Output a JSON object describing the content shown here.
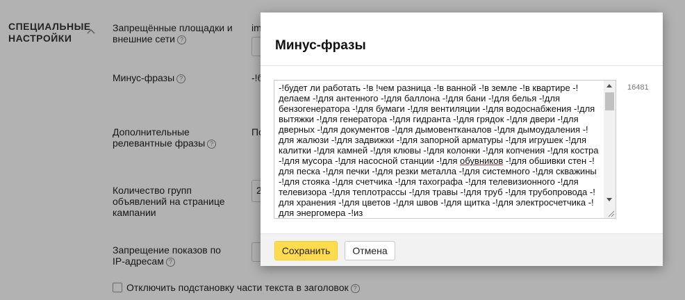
{
  "settings": {
    "section_title": "СПЕЦИАЛЬНЫЕ НАСТРОЙКИ",
    "rows": [
      {
        "label": "Запрещённые площадки и внешние сети",
        "peek": "im"
      },
      {
        "label": "Минус-фразы",
        "peek": "-!б"
      },
      {
        "label": "Дополнительные релевантные фразы",
        "peek": "По"
      },
      {
        "label": "Количество групп объявлений на странице кампании",
        "peek": "2"
      },
      {
        "label": "Запрещение показов по IP-адресам",
        "peek": ""
      }
    ],
    "checkbox_label": "Отключить подстановку части текста в заголовок",
    "help_glyph": "?"
  },
  "modal": {
    "title": "Минус-фразы",
    "text_before_underline": "-!будет ли работать -!в !чем разница -!в ванной -!в земле -!в квартире -!делаем -!для антенного -!для баллона -!для бани -!для белья -!для бензогенератора -!для бумаги -!для вентиляции -!для водоснабжения -!для вытяжки -!для генератора -!для гидранта -!для грядок -!для двери -!для дверных -!для документов -!для дымовентканалов -!для дымоудаления -!для жалюзи -!для задвижки -!для запорной арматуры -!для игрушек -!для калитки -!для камней -!для клювы -!для колонки -!для копчения -!для костра -!для мусора -!для насосной станции -!для ",
    "underlined_word": "обувников",
    "text_after_underline": " -!для обшивки стен -!для песка -!для печки -!для резки металла -!для системного -!для скважины -!для стояка -!для счетчика -!для тахографа -!для телевизионного -!для телевизора -!для теплотрассы -!для травы -!для труб -!для трубопровода -!для хранения -!для цветов -!для швов -!для щитка -!для электросчетчика -!для энергомера -!из",
    "char_count": "16481",
    "save_label": "Сохранить",
    "cancel_label": "Отмена"
  },
  "colors": {
    "accent_button": "#ffdb4d",
    "overlay": "rgba(0,0,0,0.30)"
  }
}
